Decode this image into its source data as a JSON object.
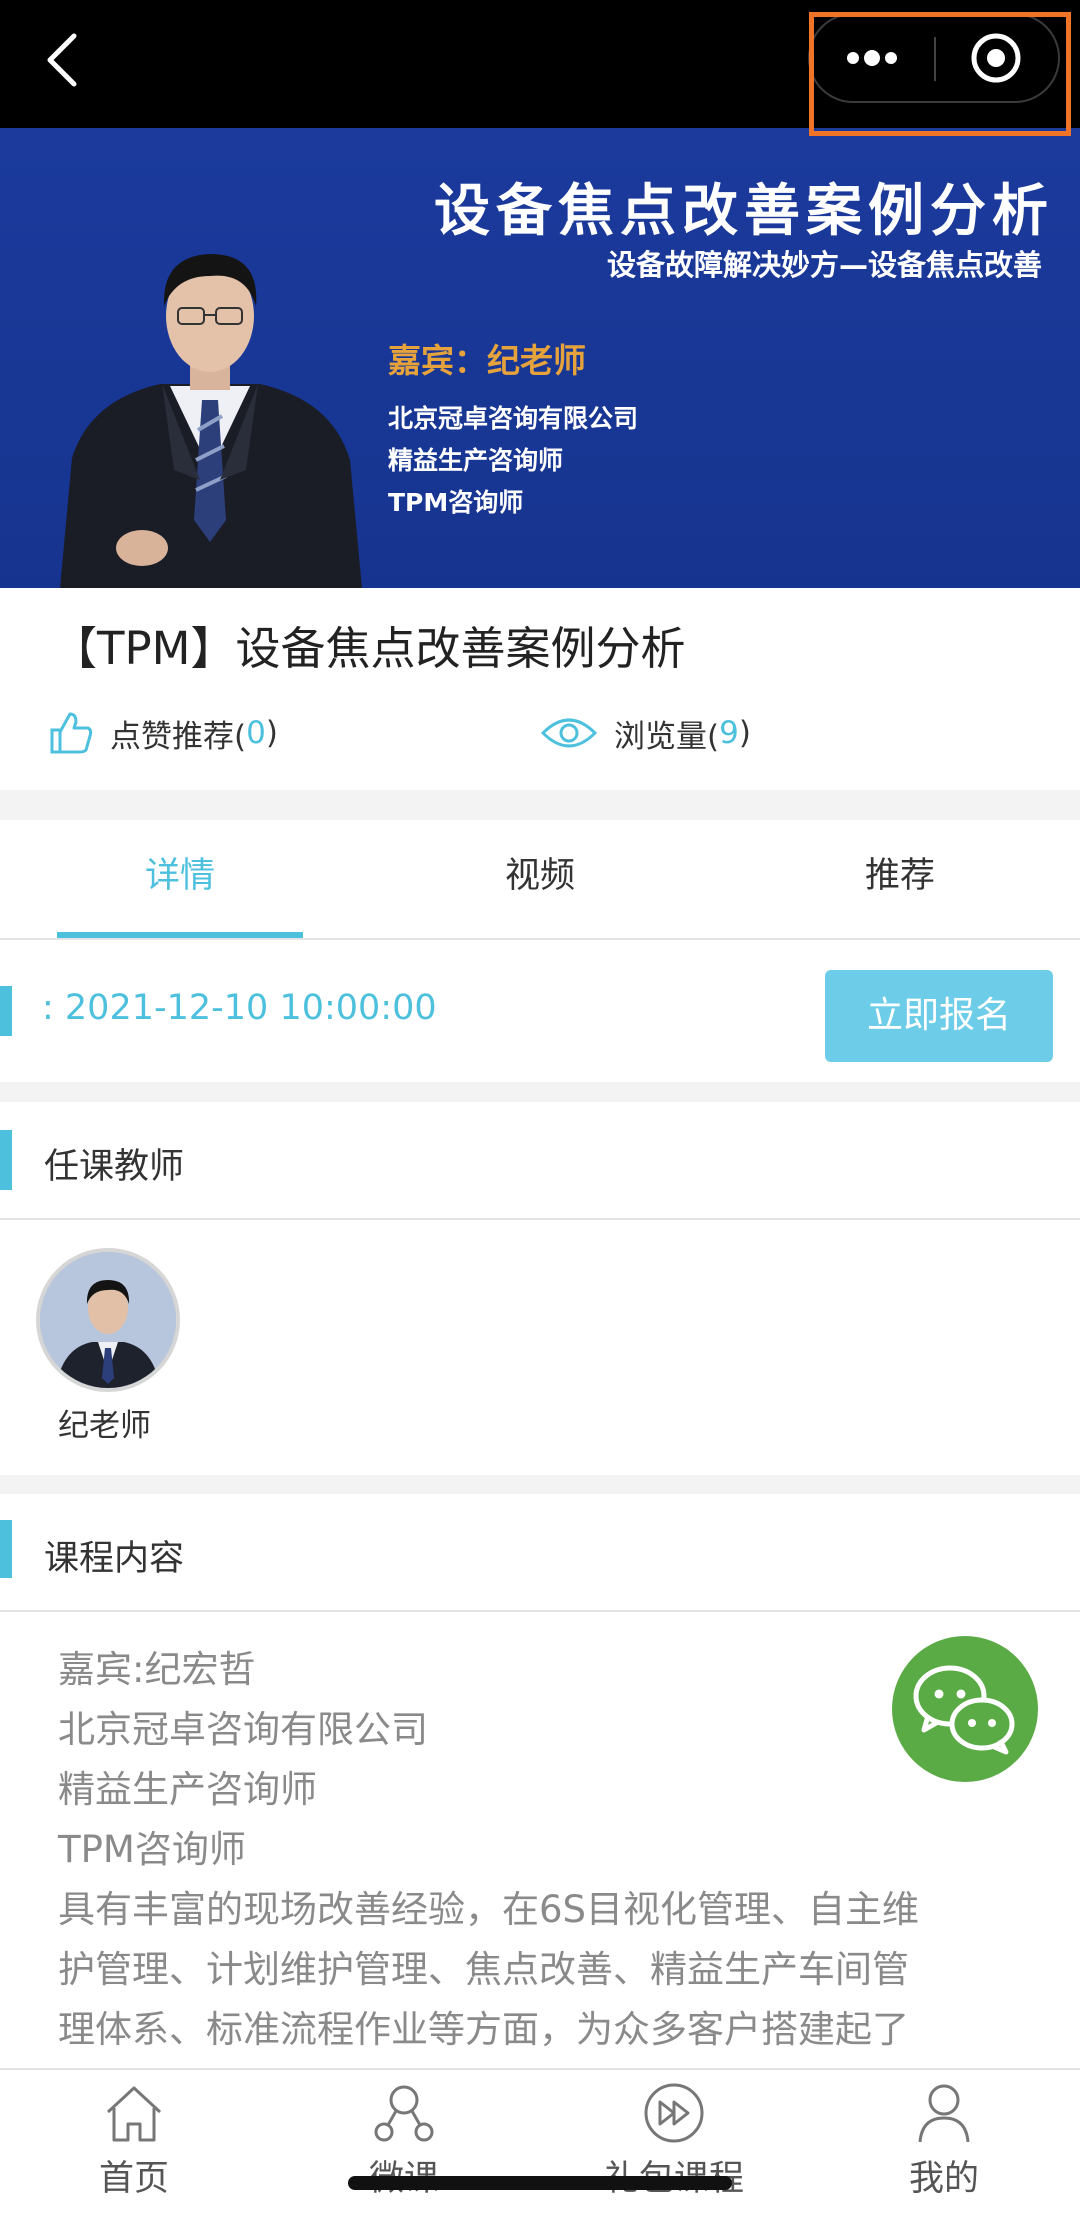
{
  "banner": {
    "title": "设备焦点改善案例分析",
    "subtitle": "设备故障解决妙方—设备焦点改善",
    "guest": "嘉宾：纪老师",
    "lines": [
      "北京冠卓咨询有限公司",
      "精益生产咨询师",
      "TPM咨询师"
    ]
  },
  "course": {
    "title": "【TPM】设备焦点改善案例分析",
    "likes_label": "点赞推荐(",
    "likes_count": "0",
    "views_label": "浏览量(",
    "views_count": "9",
    "close_paren": ")"
  },
  "tabs": [
    {
      "label": "详情",
      "active": true
    },
    {
      "label": "视频",
      "active": false
    },
    {
      "label": "推荐",
      "active": false
    }
  ],
  "schedule": {
    "datetime": ": 2021-12-10 10:00:00",
    "signup_label": "立即报名"
  },
  "teacher_section": {
    "title": "任课教师",
    "teacher_name": "纪老师"
  },
  "content_section": {
    "title": "课程内容",
    "lines": [
      "嘉宾:纪宏哲",
      "北京冠卓咨询有限公司",
      "精益生产咨询师",
      "TPM咨询师",
      "具有丰富的现场改善经验，在6S目视化管理、自主维",
      "护管理、计划维护管理、焦点改善、精益生产车间管",
      "理体系、标准流程作业等方面，为众多客户搭建起了"
    ]
  },
  "bottom_nav": [
    {
      "label": "首页",
      "icon": "home-icon"
    },
    {
      "label": "微课",
      "icon": "share-nodes-icon"
    },
    {
      "label": "礼包课程",
      "icon": "fast-forward-circle-icon"
    },
    {
      "label": "我的",
      "icon": "person-icon"
    }
  ],
  "colors": {
    "accent": "#4dc0de",
    "signup_button": "#6dcde8",
    "highlight_frame": "#f07428",
    "banner_blue": "#1b3a9c",
    "guest_orange": "#e6a33c",
    "wechat_green": "#5aaa46"
  }
}
